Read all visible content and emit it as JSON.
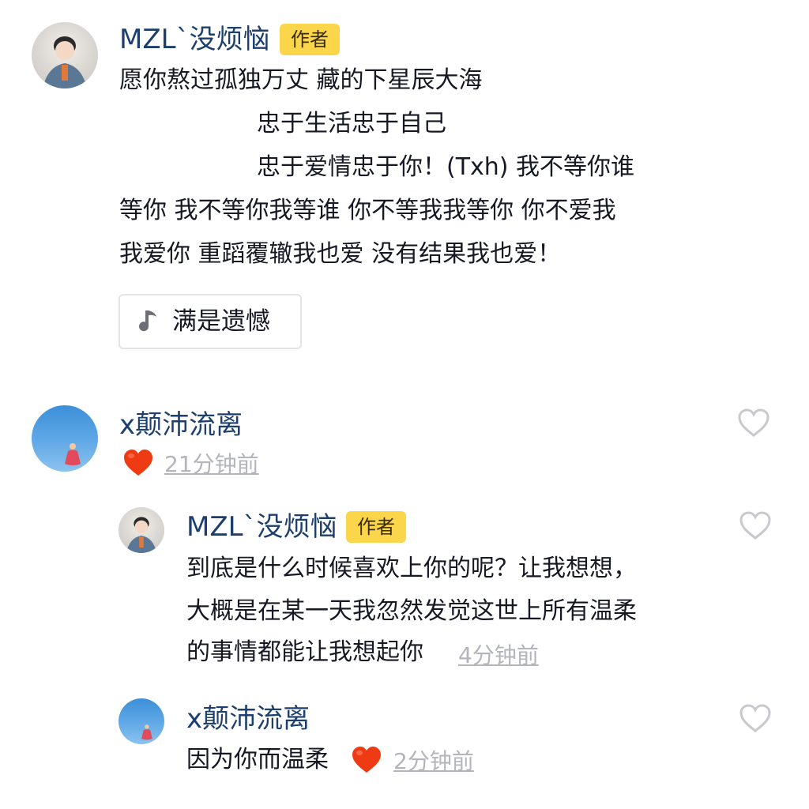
{
  "author_comment": {
    "username": "MZL`没烦恼",
    "badge": "作者",
    "lines": [
      "愿你熬过孤独万丈 藏的下星辰大海",
      "忠于生活忠于自己",
      "忠于爱情忠于你！(Txh) 我不等你谁",
      "等你 我不等你我等谁 你不等我我等你 你不爱我",
      "我爱你 重蹈覆辙我也爱 没有结果我也爱！"
    ],
    "music": {
      "icon": "music-note-icon",
      "title": "满是遗憾"
    }
  },
  "comment": {
    "username": "x颠沛流离",
    "time": "21分钟前",
    "icons": {
      "emoji": "red-heart-emoji",
      "like": "heart-outline-icon"
    }
  },
  "replies": [
    {
      "username": "MZL`没烦恼",
      "badge": "作者",
      "lines": [
        "到底是什么时候喜欢上你的呢？让我想想，",
        "大概是在某一天我忽然发觉这世上所有温柔",
        "的事情都能让我想起你"
      ],
      "time": "4分钟前"
    },
    {
      "username": "x颠沛流离",
      "text": "因为你而温柔",
      "time": "2分钟前"
    }
  ],
  "colors": {
    "username": "#1c3f6e",
    "badge_bg": "#fbd54a",
    "timestamp": "#b3b5bb",
    "emoji_heart": "#ee3b14",
    "like_outline": "#c8c9cc"
  }
}
